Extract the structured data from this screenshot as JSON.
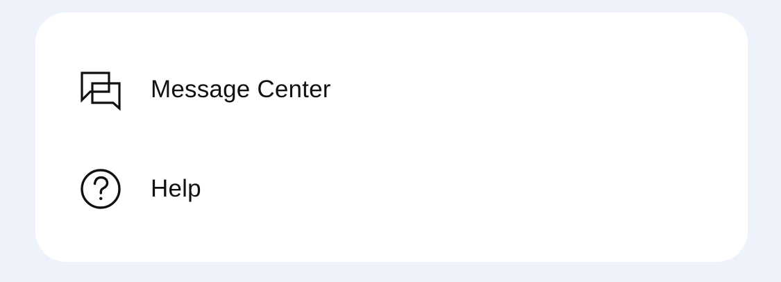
{
  "colors": {
    "page_background": "#eef2fb",
    "card_background": "#ffffff",
    "text": "#111111",
    "icon": "#111111"
  },
  "menu": {
    "items": [
      {
        "label": "Message Center",
        "icon": "chat-bubbles-icon"
      },
      {
        "label": "Help",
        "icon": "question-circle-icon"
      }
    ]
  }
}
